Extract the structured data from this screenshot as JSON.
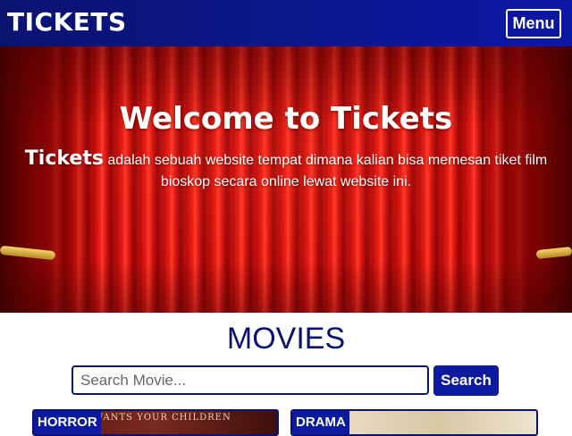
{
  "navbar": {
    "brand": "TICKETS",
    "menu_label": "Menu"
  },
  "hero": {
    "title": "Welcome to Tickets",
    "text_brand": "Tickets",
    "text": " adalah sebuah website tempat dimana kalian bisa memesan tiket film bioskop secara online lewat website ini."
  },
  "movies": {
    "title": "MOVIES",
    "search_placeholder": "Search Movie...",
    "search_label": "Search",
    "cards": [
      {
        "genre": "HORROR",
        "poster_text": "VANTS YOUR CHILDREN"
      },
      {
        "genre": "DRAMA"
      }
    ]
  },
  "colors": {
    "navy": "#0a1470",
    "button_blue": "#0b1aa0",
    "curtain_red": "#e61b14"
  }
}
